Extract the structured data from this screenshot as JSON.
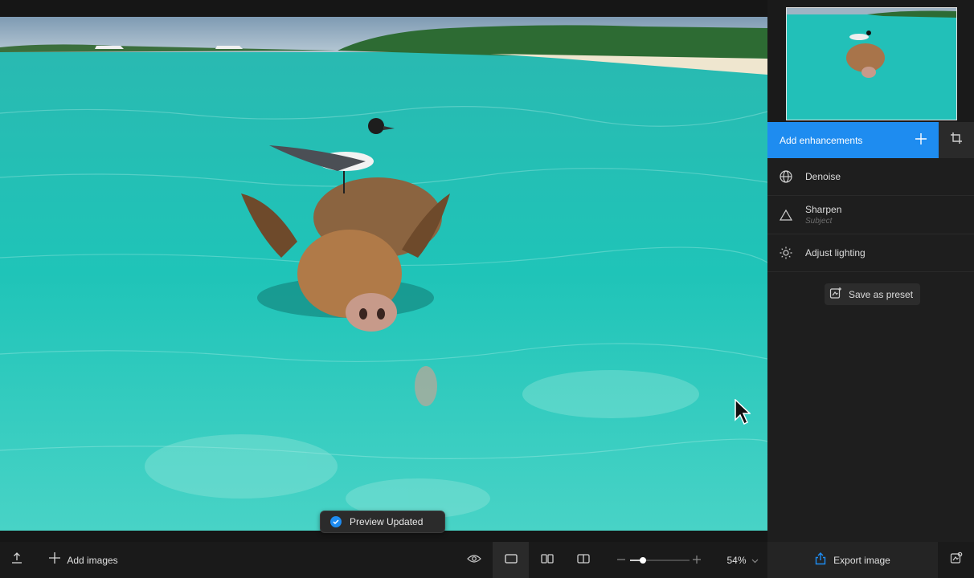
{
  "canvas": {
    "toast_text": "Preview Updated"
  },
  "panel": {
    "add_enhancements_label": "Add enhancements",
    "enhancements": [
      {
        "name": "Denoise",
        "icon": "denoise-globe-icon",
        "sub": ""
      },
      {
        "name": "Sharpen",
        "icon": "sharpen-triangle-icon",
        "sub": "Subject"
      },
      {
        "name": "Adjust lighting",
        "icon": "lighting-sun-icon",
        "sub": ""
      }
    ],
    "save_preset_label": "Save as preset"
  },
  "bottom_bar": {
    "add_images_label": "Add images",
    "zoom_level": "54%",
    "zoom_fraction": 0.22,
    "export_label": "Export image"
  },
  "colors": {
    "accent": "#1e8cf0",
    "panel_bg": "#1e1e1e",
    "bar_bg": "#1a1a1a"
  }
}
